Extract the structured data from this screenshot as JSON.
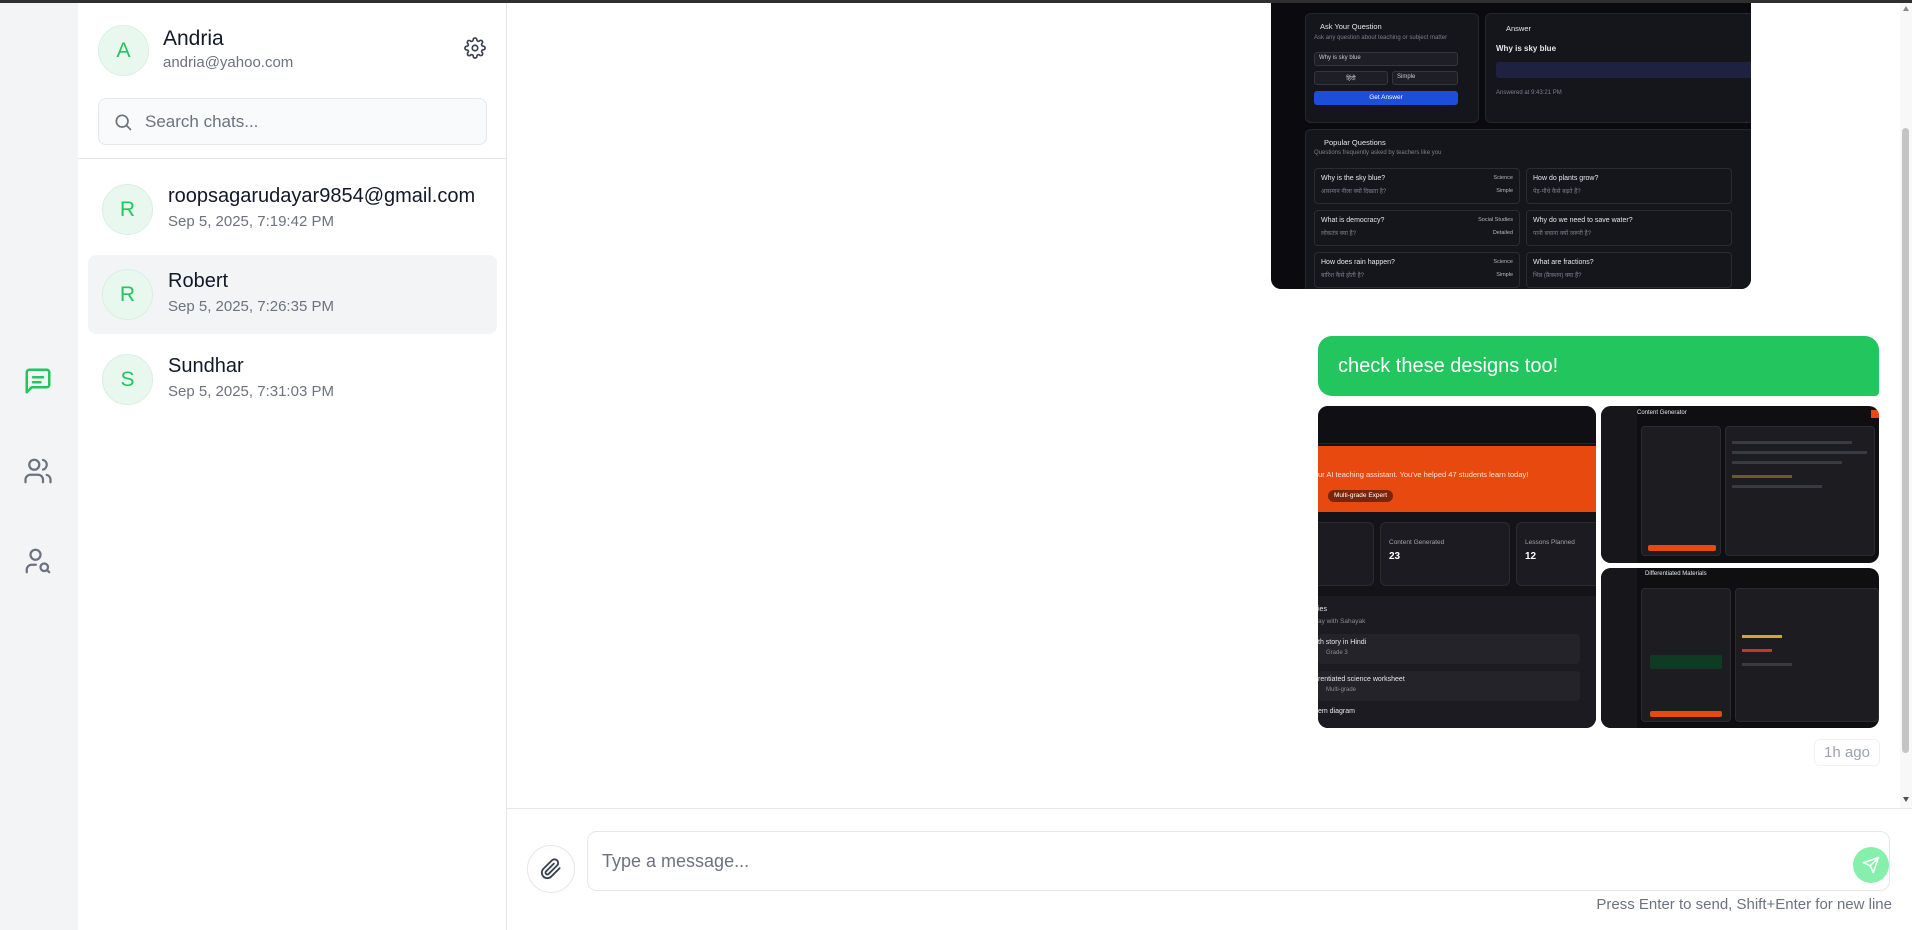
{
  "user": {
    "initial": "A",
    "name": "Andria",
    "email": "andria@yahoo.com"
  },
  "search": {
    "placeholder": "Search chats..."
  },
  "chats": [
    {
      "initial": "R",
      "name": "roopsagarudayar9854@gmail.com",
      "time": "Sep 5, 2025, 7:19:42 PM",
      "active": false
    },
    {
      "initial": "R",
      "name": "Robert",
      "time": "Sep 5, 2025, 7:26:35 PM",
      "active": true
    },
    {
      "initial": "S",
      "name": "Sundhar",
      "time": "Sep 5, 2025, 7:31:03 PM",
      "active": false
    }
  ],
  "rail": {
    "icons": [
      "chat-icon",
      "users-icon",
      "user-search-icon"
    ],
    "active": "chat-icon"
  },
  "colors": {
    "accent": "#22c55e",
    "accent_light": "#86efac",
    "avatar_bg": "#e8f8ee"
  },
  "messages": {
    "top_attachment": {
      "ask_title": "Ask Your Question",
      "ask_sub": "Ask any question about teaching or subject matter",
      "ask_value": "Why is sky blue",
      "lang": "हिंदी",
      "mode": "Simple",
      "get_answer": "Get Answer",
      "answer_title": "Answer",
      "answer_question": "Why is sky blue",
      "answer_time": "Answered at 9:43:21 PM",
      "popular_title": "Popular Questions",
      "popular_sub": "Questions frequently asked by teachers like you",
      "questions": [
        {
          "q": "Why is the sky blue?",
          "hi": "आसमान नीला क्यों दिखता है?",
          "subject": "Science",
          "level": "Simple"
        },
        {
          "q": "How do plants grow?",
          "hi": "पेड़-पौधे कैसे बढ़ते हैं?",
          "subject": "",
          "level": ""
        },
        {
          "q": "What is democracy?",
          "hi": "लोकतंत्र क्या है?",
          "subject": "Social Studies",
          "level": "Detailed"
        },
        {
          "q": "Why do we need to save water?",
          "hi": "पानी बचाना क्यों जरूरी है?",
          "subject": "",
          "level": ""
        },
        {
          "q": "How does rain happen?",
          "hi": "बारिश कैसे होती है?",
          "subject": "Science",
          "level": "Simple"
        },
        {
          "q": "What are fractions?",
          "hi": "भिन्न (फ्रैक्शन) क्या हैं?",
          "subject": "",
          "level": ""
        }
      ]
    },
    "bubble_text": "check these designs too!",
    "dashboard_image": {
      "banner": "ur AI teaching assistant. You've helped 47 students learn today!",
      "pill": "Multi-grade Expert",
      "stat1_label": "Content Generated",
      "stat1_value": "23",
      "stat2_label": "Lessons Planned",
      "stat2_value": "12",
      "list_title": "ies",
      "list_sub": "ay with Sahayak",
      "item1": "th story in Hindi",
      "item1_sub": "Grade 3",
      "item2": "rentiated science worksheet",
      "item2_sub": "Multi-grade",
      "item3": "em diagram"
    },
    "image_b_title": "Content Generator",
    "image_c_title": "Differentiated Materials",
    "timestamp": "1h ago"
  },
  "composer": {
    "placeholder": "Type a message...",
    "hint": "Press Enter to send, Shift+Enter for new line"
  }
}
